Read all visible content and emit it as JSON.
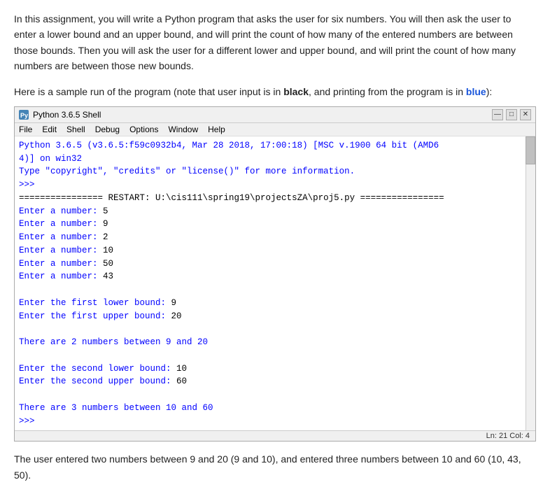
{
  "description": {
    "para1": "In this assignment, you will write a Python program that asks the user for six numbers. You will then ask the user to enter a lower bound and an upper bound, and will print the count of how many of the entered numbers are between those bounds. Then you will ask the user for a different lower and upper bound, and will print the count of how many numbers are between those new bounds.",
    "para2_prefix": "Here is a sample run of the program (note that user input is in ",
    "bold_word": "black",
    "para2_middle": ", and printing from the program is in ",
    "blue_word": "blue",
    "para2_suffix": "):"
  },
  "window": {
    "title": "Python 3.6.5 Shell",
    "controls": {
      "minimize": "—",
      "maximize": "□",
      "close": "✕"
    },
    "menu": [
      "File",
      "Edit",
      "Shell",
      "Debug",
      "Options",
      "Window",
      "Help"
    ]
  },
  "shell": {
    "line1": "Python 3.6.5 (v3.6.5:f59c0932b4, Mar 28 2018, 17:00:18) [MSC v.1900 64 bit (AMD6",
    "line2": "4)] on win32",
    "line3": "Type \"copyright\", \"credits\" or \"license()\" for more information.",
    "line4": ">>> ",
    "line5": "================ RESTART: U:\\cis111\\spring19\\projectsZA\\proj5.py ================",
    "line6": "Enter a number: 5",
    "line7": "Enter a number: 9",
    "line8": "Enter a number: 2",
    "line9": "Enter a number: 10",
    "line10": "Enter a number: 50",
    "line11": "Enter a number: 43",
    "line12": "",
    "line13": "Enter the first lower bound: 9",
    "line14": "Enter the first upper bound: 20",
    "line15": "",
    "line16": "There are 2 numbers between 9 and 20",
    "line17": "",
    "line18": "Enter the second lower bound: 10",
    "line19": "Enter the second upper bound: 60",
    "line20": "",
    "line21": "There are 3 numbers between 10 and 60",
    "line22": ">>> "
  },
  "statusbar": {
    "text": "Ln: 21  Col: 4"
  },
  "footer": {
    "text": "The user entered two numbers between 9 and 20 (9 and 10), and entered three numbers between 10 and 60 (10, 43, 50)."
  }
}
